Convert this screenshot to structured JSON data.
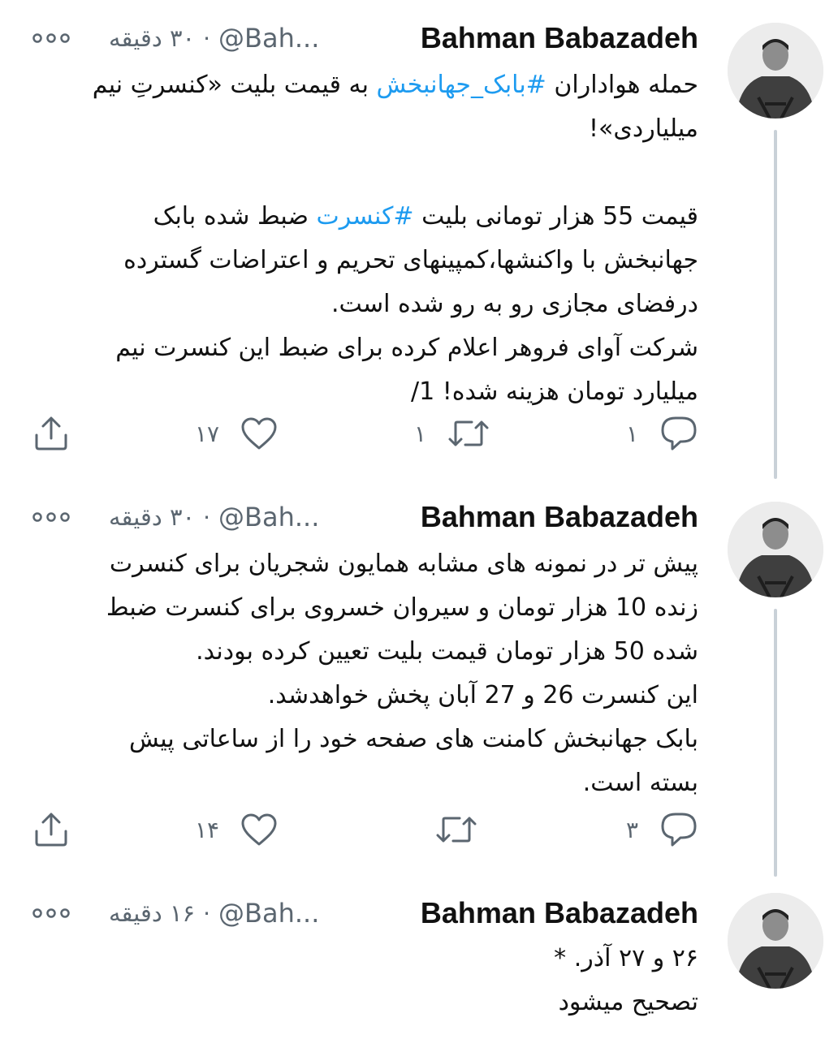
{
  "colors": {
    "text": "#111111",
    "secondary": "#5b6670",
    "hashtag": "#1d9bf0",
    "thread_line": "#c9d1d8"
  },
  "tweets": [
    {
      "name": "Bahman Babazadeh",
      "handle": "@Bah...",
      "time": "۳۰ دقیقه",
      "lines": [
        {
          "parts": [
            {
              "text": "حمله هواداران "
            },
            {
              "text": "#بابک_جهانبخش",
              "hashtag": true
            },
            {
              "text": " به قیمت بلیت «کنسرتِ نیم"
            }
          ]
        },
        {
          "parts": [
            {
              "text": "میلیاردی»!"
            }
          ]
        },
        {
          "blank": true
        },
        {
          "parts": [
            {
              "text": "قیمت 55 هزار تومانی بلیت "
            },
            {
              "text": "#کنسرت",
              "hashtag": true
            },
            {
              "text": " ضبط شده بابک"
            }
          ]
        },
        {
          "parts": [
            {
              "text": "جهانبخش با واکنشها،کمپینهای تحریم و اعتراضات گسترده"
            }
          ]
        },
        {
          "parts": [
            {
              "text": "درفضای مجازی رو به رو شده است."
            }
          ]
        },
        {
          "parts": [
            {
              "text": "شرکت آوای فروهر اعلام کرده برای ضبط این کنسرت نیم"
            }
          ]
        },
        {
          "parts": [
            {
              "text": "میلیارد تومان هزینه شده! 1/"
            }
          ]
        }
      ],
      "replies": "۱",
      "retweets": "۱",
      "likes": "۱۷"
    },
    {
      "name": "Bahman Babazadeh",
      "handle": "@Bah...",
      "time": "۳۰ دقیقه",
      "lines": [
        {
          "parts": [
            {
              "text": "پیش تر در نمونه های مشابه همایون شجریان برای کنسرت"
            }
          ]
        },
        {
          "parts": [
            {
              "text": "زنده 10 هزار تومان و سیروان خسروی برای کنسرت ضبط"
            }
          ]
        },
        {
          "parts": [
            {
              "text": "شده 50 هزار تومان قیمت بلیت تعیین کرده بودند."
            }
          ]
        },
        {
          "parts": [
            {
              "text": "این کنسرت 26 و 27 آبان پخش خواهدشد."
            }
          ]
        },
        {
          "parts": [
            {
              "text": "بابک جهانبخش کامنت های صفحه خود را از ساعاتی پیش"
            }
          ]
        },
        {
          "parts": [
            {
              "text": "بسته است."
            }
          ]
        }
      ],
      "replies": "۳",
      "retweets": "",
      "likes": "۱۴"
    },
    {
      "name": "Bahman Babazadeh",
      "handle": "@Bah...",
      "time": "۱۶ دقیقه",
      "lines": [
        {
          "parts": [
            {
              "text": "۲۶ و ۲۷ آذر. *"
            }
          ]
        },
        {
          "parts": [
            {
              "text": "تصحیح میشود"
            }
          ]
        }
      ]
    }
  ],
  "icons": {
    "more": "more-dots-icon",
    "reply": "reply-bubble-icon",
    "retweet": "retweet-arrows-icon",
    "like": "heart-icon",
    "share": "share-upload-icon"
  }
}
